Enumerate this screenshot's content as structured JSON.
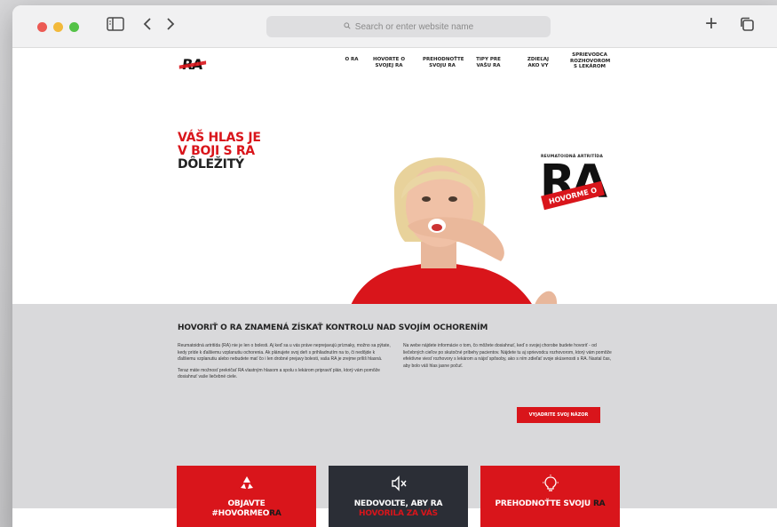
{
  "browser": {
    "address_placeholder": "Search or enter website name",
    "new_tab": "+",
    "tabs_icon": "copy-icon"
  },
  "nav": {
    "logo": "RA",
    "items": [
      {
        "label": "O RA"
      },
      {
        "label": "HOVORTE O SVOJEJ RA"
      },
      {
        "label": "PREHODNOŤTE SVOJU RA"
      },
      {
        "label": "TIPY PRE VAŠU RA"
      },
      {
        "label": "ZDIEĽAJ AKO VY"
      },
      {
        "label": "SPRIEVODCA ROZHOVOROM S LEKÁROM"
      }
    ]
  },
  "hero": {
    "tagline_line1": "VÁŠ HLAS JE",
    "tagline_line2": "V BOJI S RA",
    "tagline_line3": "DÔLEŽITÝ",
    "badge_sub": "REUMATOIDNÁ ARTRITÍDA",
    "badge_main": "RA",
    "badge_strip": "HOVORME O"
  },
  "info": {
    "title": "HOVORIŤ O RA ZNAMENÁ ZÍSKAŤ KONTROLU NAD SVOJÍM OCHORENÍM",
    "left_p1": "Reumatoidná artritída (RA) nie je len o bolesti. Aj keď sa u vás práve neprejavujú príznaky, možno sa pýtate, kedy príde k ďalšiemu vzplanutiu ochorenia. Ak plánujete svoj deň s prihliadnutím na to, či nedôjde k ďalšiemu vzplanutiu alebo nebudete mať čo i len drobné prejavy bolesti, vaša RA je zrejme príliš hlasná.",
    "left_p2": "Teraz máte možnosť prekričať RA vlastným hlasom a spolu s lekárom pripraviť plán, ktorý vám pomôže dosiahnuť vaše liečebné ciele.",
    "right_p1": "Na webe nájdete informácie o tom, čo môžete dosiahnuť, keď o svojej chorobe budete hovoriť - od liečebných cieľov po skutočné príbehy pacientov. Nájdete tu aj sprievodcu rozhovorom, ktorý vám pomôže efektívne viesť rozhovory s lekárom a nájsť spôsoby, ako s ním zdieľať svoje skúsenosti s RA. Nastal čas, aby bolo váš hlas jasne počuť.",
    "cta": "VYJADRITE SVOJ NÁZOR"
  },
  "cards": [
    {
      "line1": "OBJAVTE",
      "line2a": "#HOVORMEO",
      "line2b": "RA",
      "icon": "recycle-icon"
    },
    {
      "line1": "NEDOVOĽTE, ABY RA",
      "line2a": "HOVORILA ZA VÁS",
      "line2b": "",
      "icon": "mute-icon"
    },
    {
      "line1": "PREHODNOŤTE SVOJU",
      "line2a": "",
      "line2b": "RA",
      "icon": "lightbulb-icon"
    }
  ],
  "colors": {
    "brand_red": "#d9151b",
    "dark": "#2b2e36",
    "info_bg": "#d9d9db"
  }
}
